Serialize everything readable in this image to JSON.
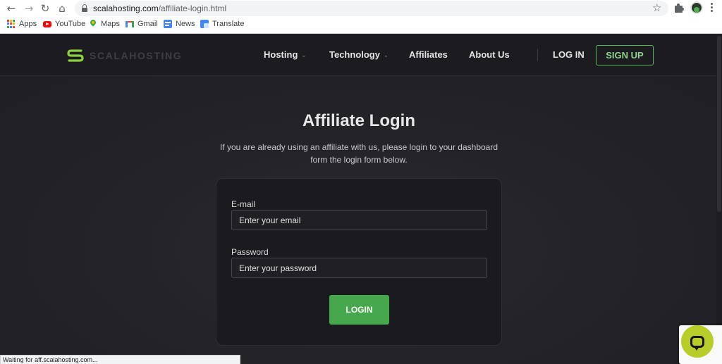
{
  "browser": {
    "url_host": "scalahosting.com",
    "url_path": "/affiliate-login.html",
    "bookmarks": [
      {
        "label": "Apps",
        "icon": "apps-grid-icon"
      },
      {
        "label": "YouTube",
        "icon": "youtube-icon"
      },
      {
        "label": "Maps",
        "icon": "maps-pin-icon"
      },
      {
        "label": "Gmail",
        "icon": "gmail-icon"
      },
      {
        "label": "News",
        "icon": "news-icon"
      },
      {
        "label": "Translate",
        "icon": "translate-icon"
      }
    ],
    "status_text": "Waiting for aff.scalahosting.com..."
  },
  "site": {
    "logo_text": "SCALAHOSTING",
    "nav": {
      "hosting": "Hosting",
      "technology": "Technology",
      "affiliates": "Affiliates",
      "about": "About Us",
      "login": "LOG IN",
      "signup": "SIGN UP"
    }
  },
  "main": {
    "title": "Affiliate Login",
    "subtitle": "If you are already using an affiliate with us, please login to your dashboard form the login form below.",
    "form": {
      "email_label": "E-mail",
      "email_placeholder": "Enter your email",
      "password_label": "Password",
      "password_placeholder": "Enter your password",
      "submit_label": "LOGIN"
    }
  },
  "colors": {
    "accent_green": "#45a84d",
    "logo_green": "#8ccf3f",
    "chat_yellow": "#b8cc2a",
    "background": "#222226"
  }
}
